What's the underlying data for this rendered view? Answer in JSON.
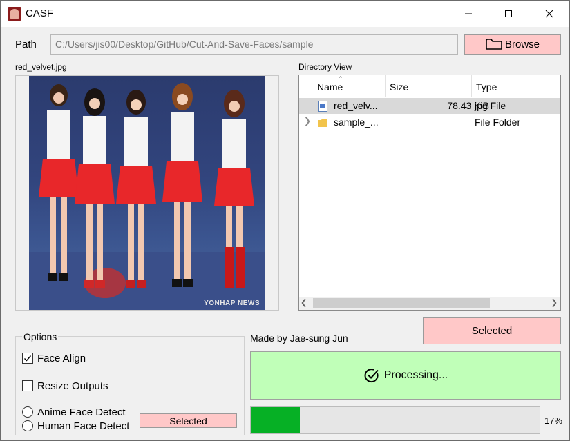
{
  "window": {
    "title": "CASF"
  },
  "path": {
    "label": "Path",
    "value": "C:/Users/jis00/Desktop/GitHub/Cut-And-Save-Faces/sample"
  },
  "browse": {
    "label": "Browse"
  },
  "image_panel": {
    "caption": "red_velvet.jpg",
    "watermark": "YONHAP NEWS"
  },
  "directory": {
    "caption": "Directory View",
    "columns": [
      "Name",
      "Size",
      "Type"
    ],
    "rows": [
      {
        "name": "red_velv...",
        "size": "78.43 KiB",
        "type": "jpg File",
        "icon": "image-file-icon",
        "selected": true
      },
      {
        "name": "sample_...",
        "size": "",
        "type": "File Folder",
        "icon": "folder-icon",
        "selected": false
      }
    ]
  },
  "selected_top": {
    "label": "Selected"
  },
  "made_by": "Made by Jae-sung Jun",
  "options": {
    "title": "Options",
    "face_align": {
      "label": "Face Align",
      "checked": true
    },
    "resize_outputs": {
      "label": "Resize Outputs",
      "checked": false
    },
    "anime": {
      "label": "Anime Face Detect",
      "checked": false
    },
    "human": {
      "label": "Human Face Detect",
      "checked": false
    },
    "selected_label": "Selected"
  },
  "process": {
    "label": "Processing..."
  },
  "progress": {
    "percent": 17,
    "text": "17%"
  },
  "colors": {
    "button_pink": "#ffc8c8",
    "process_green": "#c0ffb8",
    "progress_green": "#06b025",
    "selection_gray": "#d9d9d9"
  }
}
